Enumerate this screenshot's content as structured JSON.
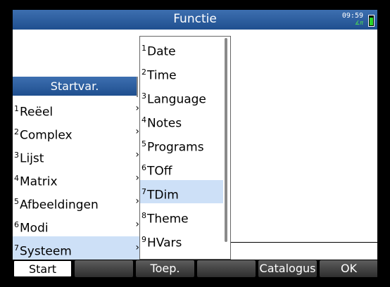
{
  "titlebar": {
    "title": "Functie",
    "clock": "09:59",
    "mode": "∡π"
  },
  "startvar": {
    "header": "Startvar.",
    "items": [
      {
        "num": "1",
        "label": "Reëel",
        "arrow": "›"
      },
      {
        "num": "2",
        "label": "Complex",
        "arrow": "›"
      },
      {
        "num": "3",
        "label": "Lijst",
        "arrow": "›"
      },
      {
        "num": "4",
        "label": "Matrix",
        "arrow": "›"
      },
      {
        "num": "5",
        "label": "Afbeeldingen",
        "arrow": "›"
      },
      {
        "num": "6",
        "label": "Modi",
        "arrow": "›"
      },
      {
        "num": "7",
        "label": "Systeem",
        "arrow": "›"
      }
    ],
    "selected_index": 6
  },
  "systeem": {
    "items": [
      {
        "num": "1",
        "label": "Date"
      },
      {
        "num": "2",
        "label": "Time"
      },
      {
        "num": "3",
        "label": "Language"
      },
      {
        "num": "4",
        "label": "Notes"
      },
      {
        "num": "5",
        "label": "Programs"
      },
      {
        "num": "6",
        "label": "TOff"
      },
      {
        "num": "7",
        "label": "TDim"
      },
      {
        "num": "8",
        "label": "Theme"
      },
      {
        "num": "9",
        "label": "HVars"
      }
    ],
    "selected_index": 6
  },
  "softkeys": [
    "Start",
    "",
    "Toep.",
    "",
    "Catalogus",
    "OK"
  ],
  "colors": {
    "accent": "#1f4f8f",
    "selection": "#cde0f7"
  }
}
